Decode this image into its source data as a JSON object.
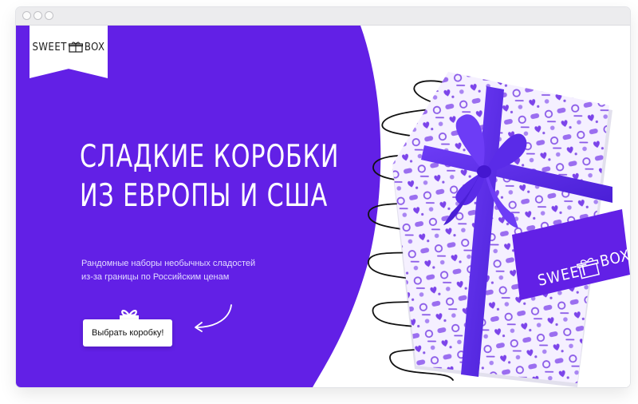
{
  "window": {
    "controls": [
      "close",
      "minimize",
      "maximize"
    ]
  },
  "logo": {
    "word1": "SWEET",
    "word2": "BOX",
    "icon": "gift-box-icon"
  },
  "hero": {
    "headline_line1": "СЛАДКИЕ КОРОБКИ",
    "headline_line2": "ИЗ ЕВРОПЫ И США",
    "subtitle_line1": "Рандомные наборы необычных сладостей",
    "subtitle_line2": "из-за границы по Российским ценам",
    "cta_label": "Выбрать коробку!"
  },
  "box": {
    "logo_word1": "SWEET",
    "logo_word2": "BOX"
  },
  "colors": {
    "brand_purple": "#6220e6",
    "pattern_purple": "#8a5ae8",
    "ribbon_purple": "#5b2ef0",
    "white": "#ffffff"
  }
}
